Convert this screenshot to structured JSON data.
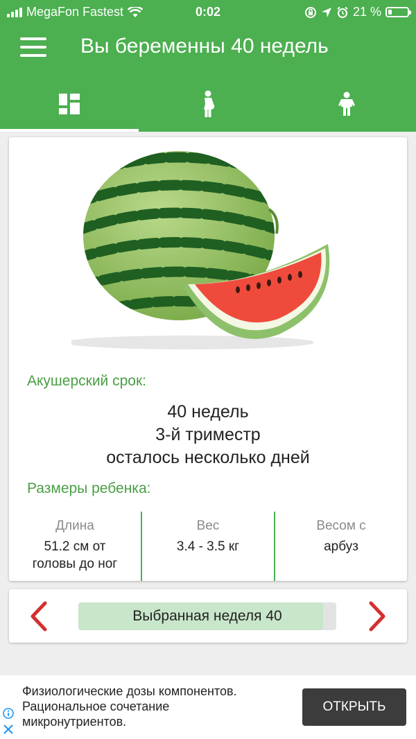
{
  "status_bar": {
    "carrier": "MegaFon Fastest",
    "time": "0:02",
    "battery_percent": "21 %",
    "battery_level": 0.21
  },
  "toolbar": {
    "title": "Вы беременны 40 недель"
  },
  "tabs": [
    {
      "icon": "dashboard-icon",
      "active": true
    },
    {
      "icon": "pregnant-woman-icon",
      "active": false
    },
    {
      "icon": "child-icon",
      "active": false
    }
  ],
  "main": {
    "illustration": "watermelon-image",
    "term_label": "Акушерский срок:",
    "term_lines": [
      "40 недель",
      "3-й триместр",
      "осталось несколько дней"
    ],
    "sizes_label": "Размеры ребенка:",
    "sizes": [
      {
        "header": "Длина",
        "value": "51.2 см от головы до ног"
      },
      {
        "header": "Вес",
        "value": "3.4 - 3.5 кг"
      },
      {
        "header": "Весом с",
        "value": "арбуз"
      }
    ]
  },
  "week_nav": {
    "label": "Выбранная неделя 40",
    "progress": 0.95,
    "prev_icon": "chevron-left-icon",
    "next_icon": "chevron-right-icon"
  },
  "ad": {
    "text": "Физиологические дозы компонентов. Рациональное сочетание микронутриентов.",
    "button": "ОТКРЫТЬ"
  },
  "colors": {
    "brand_green": "#4caf50",
    "label_green": "#4a9d45",
    "arrow_red": "#d32f2f"
  }
}
